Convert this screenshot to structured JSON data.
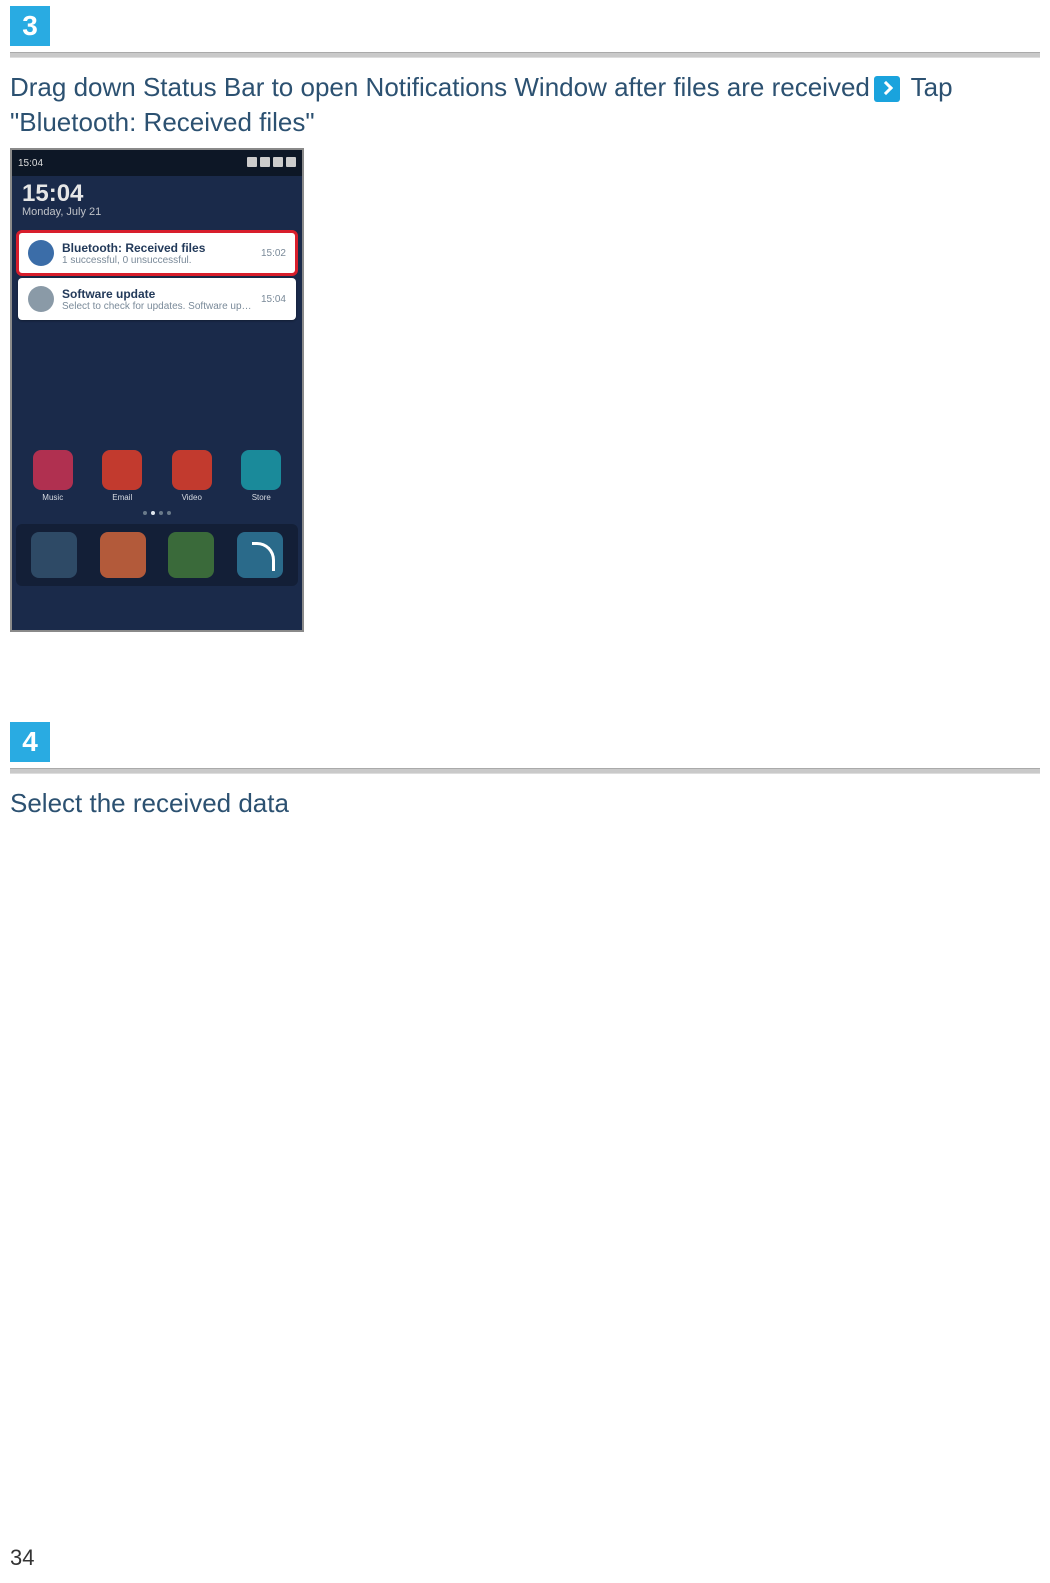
{
  "page_number": "34",
  "steps": [
    {
      "badge": "3",
      "text_before": "Drag down Status Bar to open Notifications Window after files are received",
      "text_after": " Tap \"Bluetooth: Received files\""
    },
    {
      "badge": "4",
      "text_before": "Select the received data",
      "text_after": ""
    }
  ],
  "phone": {
    "clock": "15:04",
    "date_line": "Monday, July 21",
    "notifications": [
      {
        "title": "Bluetooth: Received files",
        "sub": "1 successful, 0 unsuccessful.",
        "time": "15:02",
        "highlight": true,
        "kind": "bt"
      },
      {
        "title": "Software update",
        "sub": "Select to check for updates. Software upd…",
        "time": "15:04",
        "highlight": false,
        "kind": "sw"
      }
    ],
    "app_labels": [
      "Music",
      "Email",
      "Video",
      "Store"
    ]
  }
}
